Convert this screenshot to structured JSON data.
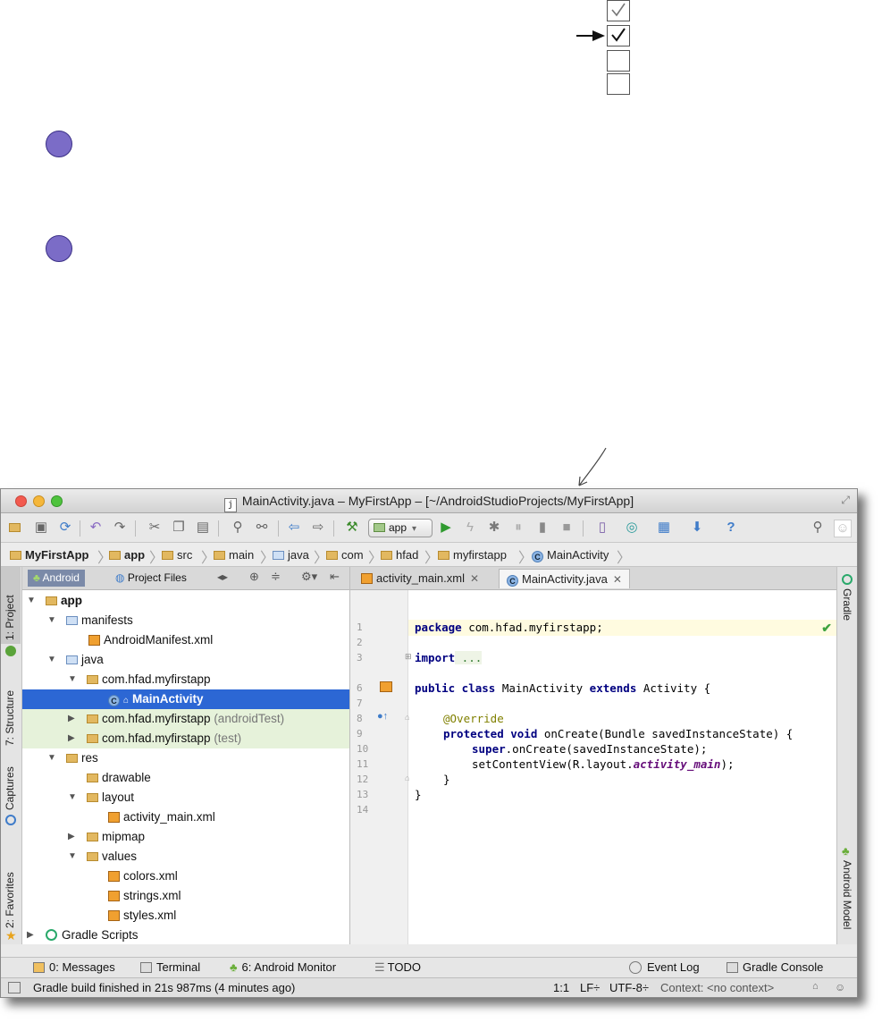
{
  "window": {
    "title": "MainActivity.java – MyFirstApp – [~/AndroidStudioProjects/MyFirstApp]",
    "title_icon": "j"
  },
  "toolbar": {
    "run_config": "app",
    "buttons": [
      "open-folder-icon",
      "save-icon",
      "sync-icon",
      "undo-icon",
      "redo-icon",
      "cut-icon",
      "copy-icon",
      "paste-icon",
      "find-icon",
      "replace-icon",
      "back-icon",
      "forward-icon",
      "build-hammer-icon",
      "run-icon",
      "apply-changes-icon",
      "debug-icon",
      "profile-icon",
      "attach-icon",
      "stop-icon",
      "avd-manager-icon",
      "sync-gradle-icon",
      "project-structure-icon",
      "sdk-manager-icon",
      "help-icon",
      "search-everywhere-icon",
      "user-icon"
    ]
  },
  "breadcrumbs": [
    "MyFirstApp",
    "app",
    "src",
    "main",
    "java",
    "com",
    "hfad",
    "myfirstapp",
    "MainActivity"
  ],
  "left_strip": {
    "project": "1: Project",
    "structure": "7: Structure",
    "captures": "Captures",
    "favorites": "2: Favorites"
  },
  "right_strip": {
    "gradle": "Gradle",
    "android_model": "Android Model"
  },
  "project_panel": {
    "tabs": [
      "Android",
      "Project Files"
    ],
    "tree": [
      {
        "label": "app",
        "suffix": ""
      },
      {
        "label": "manifests",
        "suffix": ""
      },
      {
        "label": "AndroidManifest.xml",
        "suffix": ""
      },
      {
        "label": "java",
        "suffix": ""
      },
      {
        "label": "com.hfad.myfirstapp",
        "suffix": ""
      },
      {
        "label": "MainActivity",
        "suffix": ""
      },
      {
        "label": "com.hfad.myfirstapp",
        "suffix": "(androidTest)"
      },
      {
        "label": "com.hfad.myfirstapp",
        "suffix": "(test)"
      },
      {
        "label": "res",
        "suffix": ""
      },
      {
        "label": "drawable",
        "suffix": ""
      },
      {
        "label": "layout",
        "suffix": ""
      },
      {
        "label": "activity_main.xml",
        "suffix": ""
      },
      {
        "label": "mipmap",
        "suffix": ""
      },
      {
        "label": "values",
        "suffix": ""
      },
      {
        "label": "colors.xml",
        "suffix": ""
      },
      {
        "label": "strings.xml",
        "suffix": ""
      },
      {
        "label": "styles.xml",
        "suffix": ""
      },
      {
        "label": "Gradle Scripts",
        "suffix": ""
      }
    ]
  },
  "editor": {
    "tabs": [
      "activity_main.xml",
      "MainActivity.java"
    ],
    "active_tab": "MainActivity.java",
    "line_numbers": [
      "1",
      "2",
      "3",
      "6",
      "7",
      "8",
      "9",
      "10",
      "11",
      "12",
      "13",
      "14"
    ],
    "code": {
      "l1_kw": "package",
      "l1_rest": " com.hfad.myfirstapp;",
      "l3_kw": "import",
      "l3_rest": " ...",
      "l6_kw1": "public class",
      "l6_mid": " MainActivity ",
      "l6_kw2": "extends",
      "l6_rest": " Activity {",
      "l8_ann": "@Override",
      "l9_kw": "protected void",
      "l9_rest": " onCreate(Bundle savedInstanceState) {",
      "l10_kw": "super",
      "l10_rest": ".onCreate(savedInstanceState);",
      "l11_pre": "setContentView(R.layout.",
      "l11_ital": "activity_main",
      "l11_post": ");",
      "l12": "}",
      "l13": "}"
    }
  },
  "tool_windows": {
    "messages": "0: Messages",
    "terminal": "Terminal",
    "android_monitor": "6: Android Monitor",
    "todo": "TODO",
    "event_log": "Event Log",
    "gradle_console": "Gradle Console"
  },
  "status": {
    "message": "Gradle build finished in 21s 987ms (4 minutes ago)",
    "position": "1:1",
    "line_sep": "LF÷",
    "encoding": "UTF-8÷",
    "context": "Context: <no context>"
  },
  "colors": {
    "selection": "#2c67d4",
    "dot": "#7b6cc7",
    "keyword": "#000080"
  }
}
